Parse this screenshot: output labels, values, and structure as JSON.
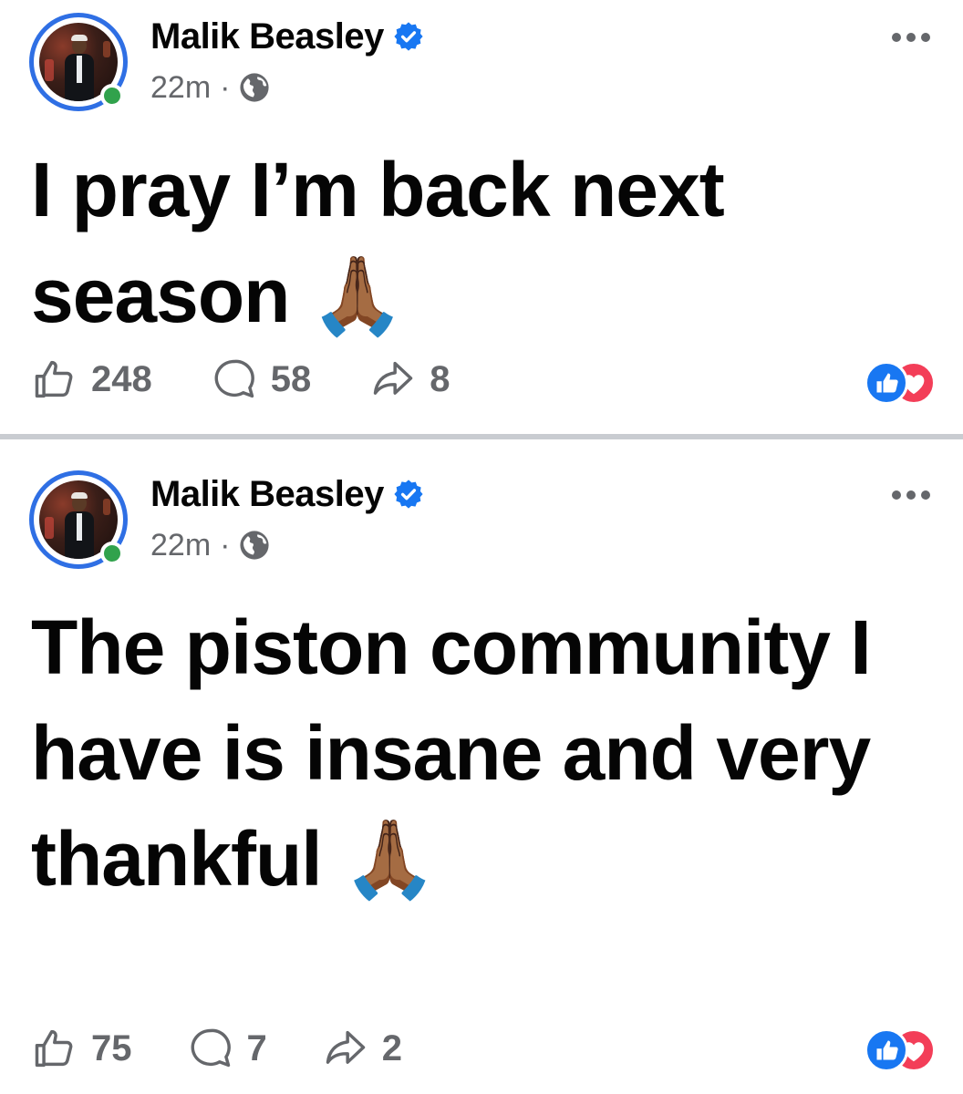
{
  "posts": [
    {
      "author": "Malik Beasley",
      "time": "22m",
      "separator": "·",
      "text": "I pray I’m back next season 🙏🏾",
      "likes": "248",
      "comments": "58",
      "shares": "8"
    },
    {
      "author": "Malik Beasley",
      "time": "22m",
      "separator": "·",
      "text": "The piston community I have is insane and very thankful 🙏🏾",
      "likes": "75",
      "comments": "7",
      "shares": "2"
    }
  ],
  "colors": {
    "accent": "#1877f2",
    "verified": "#1877f2",
    "online": "#31a24c",
    "love": "#f33e58",
    "muted": "#65676b",
    "divider": "#c9ccd1"
  }
}
